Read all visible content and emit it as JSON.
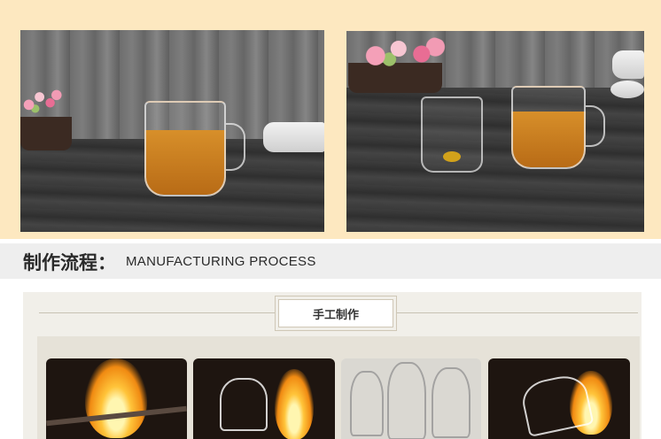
{
  "section_heading": {
    "chinese": "制作流程：",
    "english": "MANUFACTURING PROCESS"
  },
  "process_badge": "手工制作",
  "colors": {
    "top_band": "#fde8c0",
    "heading_band": "#eeeeee",
    "panel": "#f1efe9"
  }
}
